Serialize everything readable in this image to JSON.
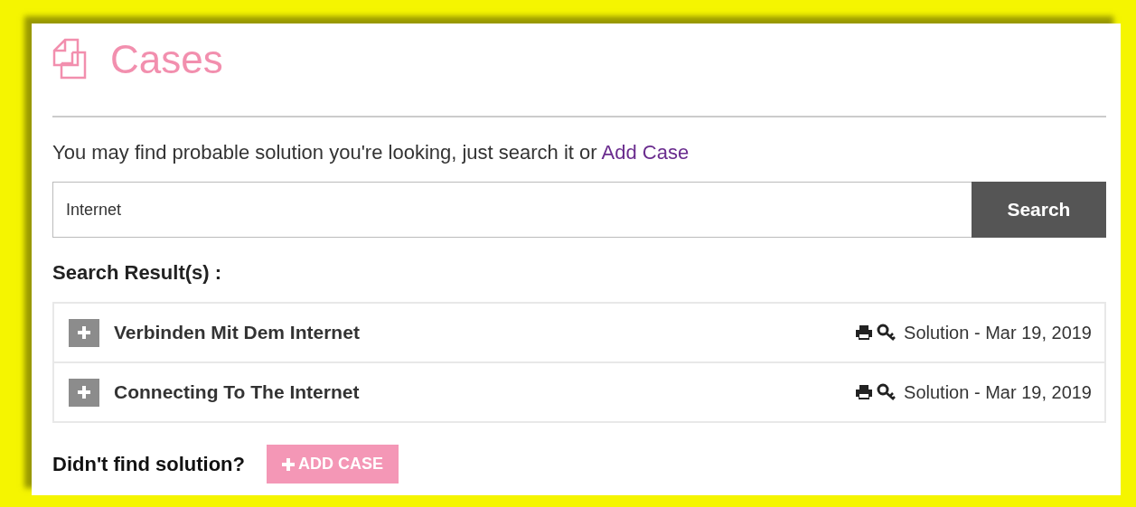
{
  "title": "Cases",
  "intro": {
    "text": "You may find probable solution you're looking, just search it or",
    "link": "Add Case"
  },
  "search": {
    "value": "Internet",
    "button": "Search"
  },
  "results_heading": "Search Result(s) :",
  "results": [
    {
      "title": "Verbinden Mit Dem Internet",
      "expanded": false,
      "meta": "Solution - Mar 19, 2019"
    },
    {
      "title": "Connecting To The Internet",
      "expanded": false,
      "meta": "Solution - Mar 19, 2019"
    }
  ],
  "footer": {
    "text": "Didn't find solution?",
    "button": "ADD CASE"
  }
}
